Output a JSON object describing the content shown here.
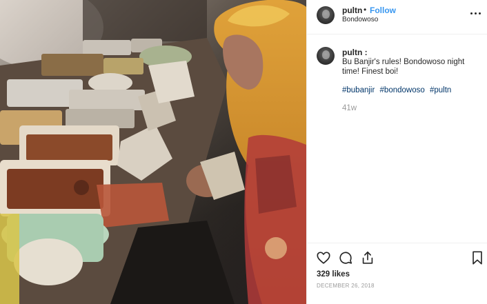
{
  "post": {
    "author": "pultn",
    "separator": "•",
    "follow_label": "Follow",
    "location": "Bondowoso",
    "options_icon": "more-horizontal-icon"
  },
  "caption": {
    "author": "pultn :",
    "text": "Bu Banjir's rules! Bondowoso night time! Finest boi!",
    "hashtags": [
      "#bubanjir",
      "#bondowoso",
      "#pultn"
    ],
    "age": "41w"
  },
  "actions": {
    "like_icon": "heart-icon",
    "comment_icon": "comment-icon",
    "share_icon": "share-icon",
    "save_icon": "bookmark-icon"
  },
  "stats": {
    "likes": "329 likes",
    "date": "DECEMBER 26, 2018"
  },
  "colors": {
    "accent": "#3897f0",
    "hashtag": "#003569",
    "muted": "#999999",
    "text": "#262626",
    "border": "#efefef"
  }
}
